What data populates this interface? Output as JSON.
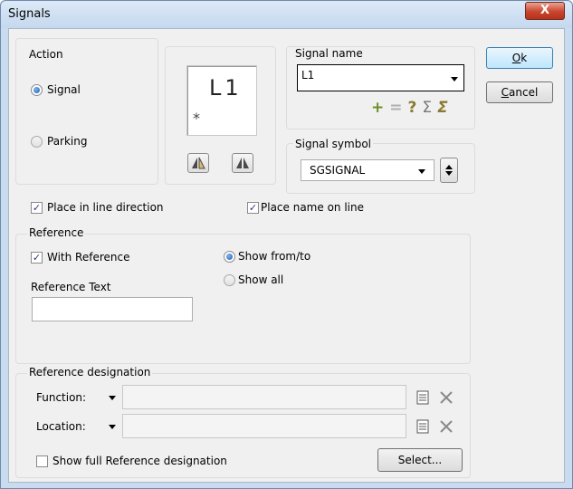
{
  "window": {
    "title": "Signals",
    "close_glyph": "X"
  },
  "action": {
    "label": "Action",
    "options": [
      {
        "label": "Signal",
        "selected": true
      },
      {
        "label": "Parking",
        "selected": false
      }
    ]
  },
  "preview": {
    "text": "L1",
    "marker": "*"
  },
  "signal_name": {
    "label": "Signal name",
    "value": "L1"
  },
  "signal_symbol": {
    "label": "Signal symbol",
    "value": "SGSIGNAL"
  },
  "toolbar_glyphs": {
    "plus": "+",
    "minus": "=",
    "question": "?",
    "sigma": "Σ",
    "sigma_check": "Σ"
  },
  "checks": {
    "place_in_line_direction": {
      "label": "Place in line direction",
      "checked": true
    },
    "place_name_on_line": {
      "label": "Place name on line",
      "checked": true
    }
  },
  "reference": {
    "label": "Reference",
    "with_reference": {
      "label": "With Reference",
      "checked": true
    },
    "reference_text_label": "Reference Text",
    "reference_text_value": "",
    "show_options": [
      {
        "label": "Show from/to",
        "selected": true
      },
      {
        "label": "Show all",
        "selected": false
      }
    ]
  },
  "reference_designation": {
    "label": "Reference designation",
    "function_label": "Function:",
    "function_value": "",
    "location_label": "Location:",
    "location_value": "",
    "show_full": {
      "label": "Show full Reference designation",
      "checked": false
    },
    "select_button": "Select..."
  },
  "buttons": {
    "ok_underline": "O",
    "ok_rest": "k",
    "cancel_underline": "C",
    "cancel_rest": "ancel"
  }
}
